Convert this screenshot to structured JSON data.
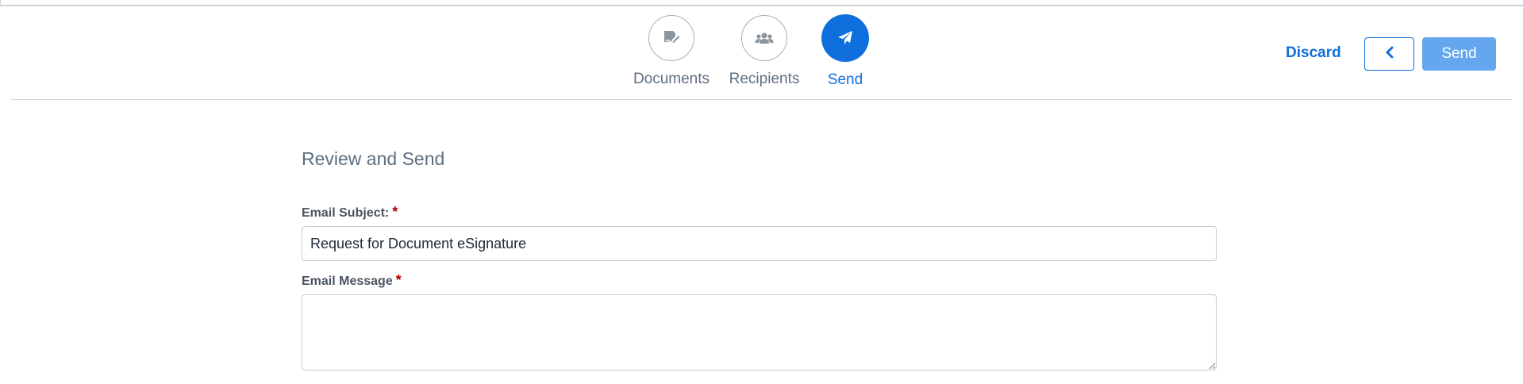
{
  "stepper": {
    "steps": [
      {
        "label": "Documents",
        "icon": "document-sign-icon",
        "active": false
      },
      {
        "label": "Recipients",
        "icon": "users-icon",
        "active": false
      },
      {
        "label": "Send",
        "icon": "paper-plane-icon",
        "active": true
      }
    ]
  },
  "toolbar": {
    "discard_label": "Discard",
    "back_icon": "chevron-left-icon",
    "send_label": "Send"
  },
  "form": {
    "title": "Review and Send",
    "subject": {
      "label": "Email Subject:",
      "required_mark": "*",
      "value": "Request for Document eSignature"
    },
    "message": {
      "label": "Email Message",
      "required_mark": "*",
      "value": ""
    }
  },
  "colors": {
    "accent": "#0f6fdc",
    "send_button_disabled": "#64a7ee",
    "step_label": "#5e6f80",
    "required": "#b30000"
  }
}
